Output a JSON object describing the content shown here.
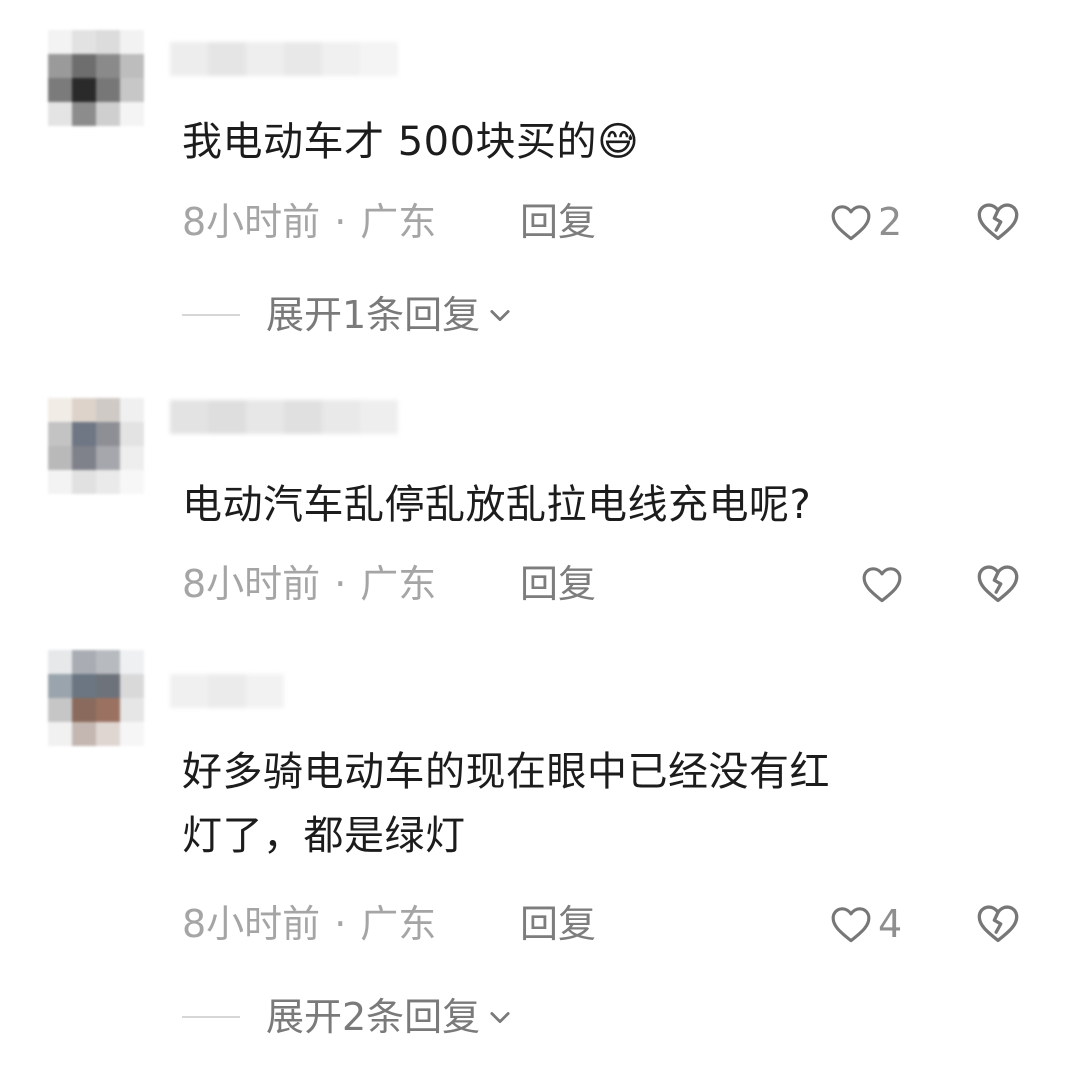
{
  "comments": [
    {
      "text": "我电动车才 500块买的",
      "emoji": "😅",
      "time": "8小时前",
      "location": "广东",
      "reply_label": "回复",
      "likes": "2",
      "expand_label": "展开1条回复"
    },
    {
      "text": "电动汽车乱停乱放乱拉电线充电呢?",
      "time": "8小时前",
      "location": "广东",
      "reply_label": "回复",
      "likes": ""
    },
    {
      "text_line1": "好多骑电动车的现在眼中已经没有红",
      "text_line2": "灯了，都是绿灯",
      "time": "8小时前",
      "location": "广东",
      "reply_label": "回复",
      "likes": "4",
      "expand_label": "展开2条回复"
    }
  ],
  "separator": "·",
  "colors": {
    "text": "#1c1c1c",
    "meta": "#a5a5a5",
    "icon": "#777777",
    "background": "#ffffff"
  },
  "icons": {
    "like": "heart-outline-icon",
    "dislike": "broken-heart-icon",
    "expand": "chevron-down-icon"
  }
}
